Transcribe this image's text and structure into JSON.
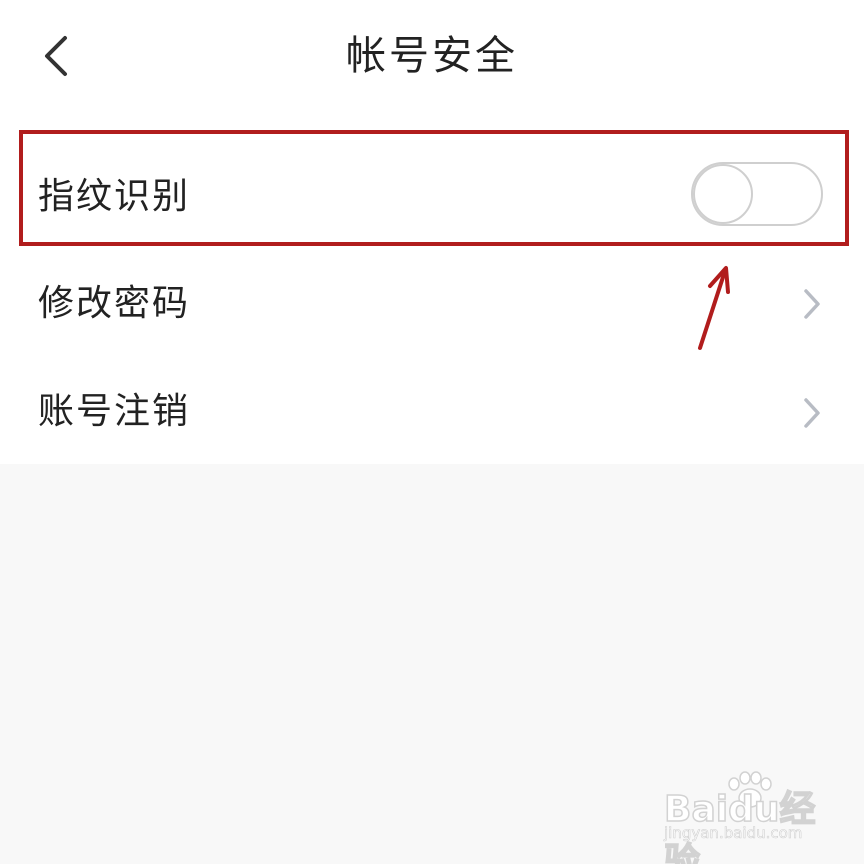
{
  "header": {
    "title": "帐号安全",
    "back_icon": "chevron-left-icon"
  },
  "settings": {
    "items": [
      {
        "label": "指纹识别",
        "control": "toggle",
        "toggle_on": false
      },
      {
        "label": "修改密码",
        "control": "chevron-right-icon"
      },
      {
        "label": "账号注销",
        "control": "chevron-right-icon"
      }
    ]
  },
  "annotation": {
    "highlight_color": "#b11d1d",
    "arrow_icon": "arrow-up-icon"
  },
  "watermark": {
    "brand": "Baidu经验",
    "url": "jingyan.baidu.com"
  },
  "colors": {
    "background": "#f8f8f8",
    "surface": "#ffffff",
    "text": "#222222",
    "toggle_border": "#cfcfcf",
    "chevron": "#b8bcc4"
  }
}
